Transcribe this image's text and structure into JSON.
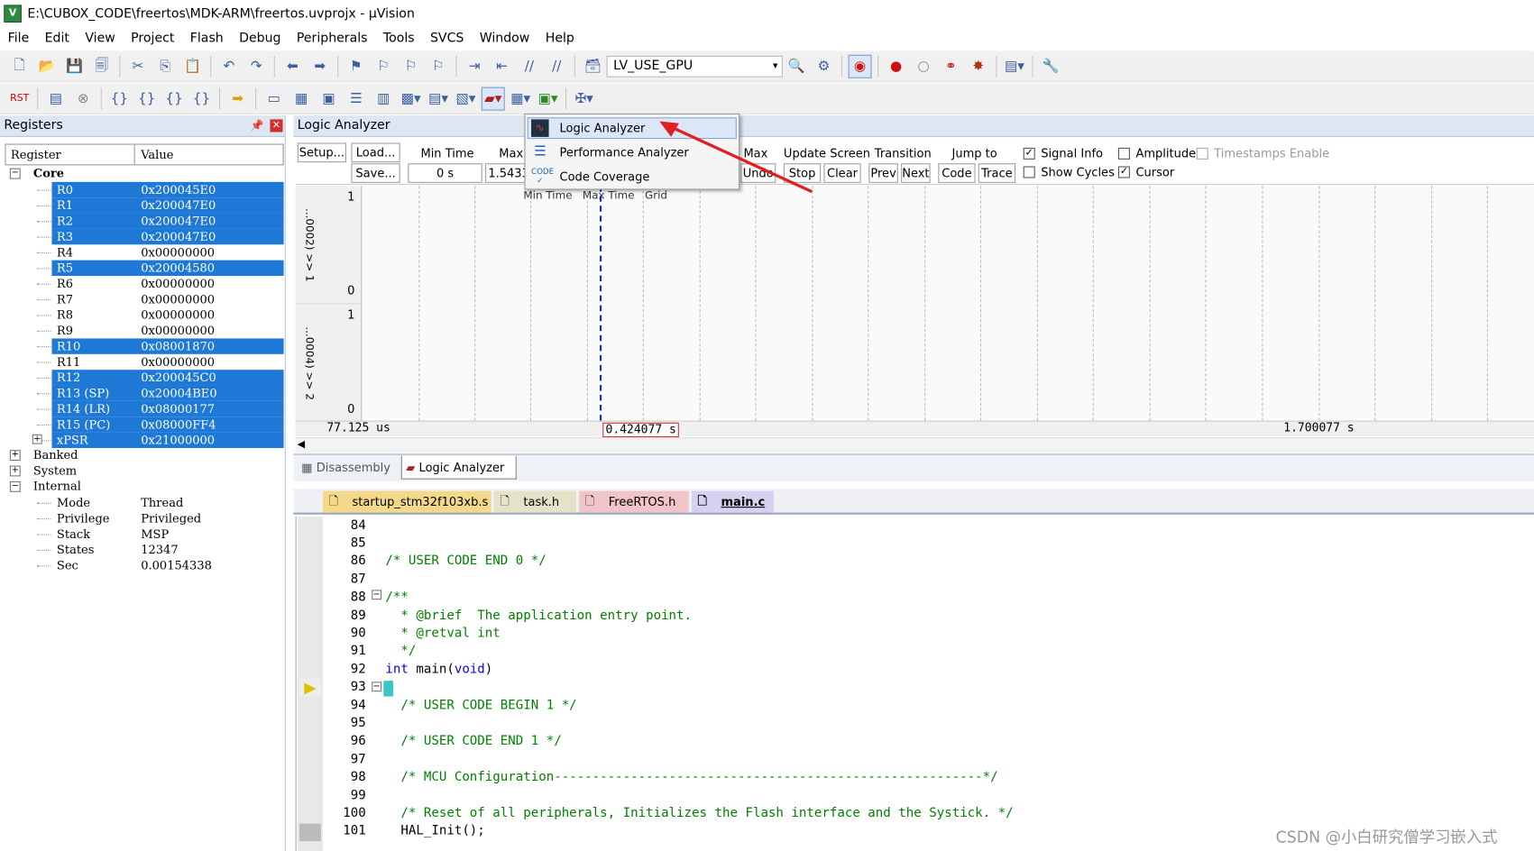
{
  "window": {
    "title": "E:\\CUBOX_CODE\\freertos\\MDK-ARM\\freertos.uvprojx - µVision",
    "app_icon": "uvision-icon"
  },
  "menu": [
    "File",
    "Edit",
    "View",
    "Project",
    "Flash",
    "Debug",
    "Peripherals",
    "Tools",
    "SVCS",
    "Window",
    "Help"
  ],
  "toolbar": {
    "target_combo": "LV_USE_GPU"
  },
  "registers": {
    "panel_title": "Registers",
    "col_register": "Register",
    "col_value": "Value",
    "groups": {
      "core": "Core",
      "banked": "Banked",
      "system": "System",
      "internal": "Internal"
    },
    "core": [
      {
        "name": "R0",
        "value": "0x200045E0"
      },
      {
        "name": "R1",
        "value": "0x200047E0"
      },
      {
        "name": "R2",
        "value": "0x200047E0"
      },
      {
        "name": "R3",
        "value": "0x200047E0"
      },
      {
        "name": "R4",
        "value": "0x00000000"
      },
      {
        "name": "R5",
        "value": "0x20004580"
      },
      {
        "name": "R6",
        "value": "0x00000000"
      },
      {
        "name": "R7",
        "value": "0x00000000"
      },
      {
        "name": "R8",
        "value": "0x00000000"
      },
      {
        "name": "R9",
        "value": "0x00000000"
      },
      {
        "name": "R10",
        "value": "0x08001870"
      },
      {
        "name": "R11",
        "value": "0x00000000"
      },
      {
        "name": "R12",
        "value": "0x200045C0"
      },
      {
        "name": "R13 (SP)",
        "value": "0x20004BE0"
      },
      {
        "name": "R14 (LR)",
        "value": "0x08000177"
      },
      {
        "name": "R15 (PC)",
        "value": "0x08000FF4"
      },
      {
        "name": "xPSR",
        "value": "0x21000000"
      }
    ],
    "internal": [
      {
        "name": "Mode",
        "value": "Thread"
      },
      {
        "name": "Privilege",
        "value": "Privileged"
      },
      {
        "name": "Stack",
        "value": "MSP"
      },
      {
        "name": "States",
        "value": "12347"
      },
      {
        "name": "Sec",
        "value": "0.00154338"
      }
    ]
  },
  "logic_analyzer": {
    "panel_title": "Logic Analyzer",
    "setup": "Setup...",
    "load": "Load...",
    "save": "Save...",
    "min_time_label": "Min Time",
    "min_time": "0 s",
    "max_label": "Max",
    "max_value": "1.5433",
    "max2_label": "Max",
    "undo": "Undo",
    "update_screen": "Update Screen",
    "stop": "Stop",
    "clear": "Clear",
    "transition": "Transition",
    "prev": "Prev",
    "next": "Next",
    "jump_to": "Jump to",
    "code": "Code",
    "trace": "Trace",
    "signal_info": "Signal Info",
    "show_cycles": "Show Cycles",
    "amplitude": "Amplitude",
    "cursor": "Cursor",
    "timestamps": "Timestamps Enable",
    "signal1": "...0002) >> 1",
    "signal2": "...0004) >> 2",
    "y_hi": "1",
    "y_lo": "0",
    "time_left": "77.125 us",
    "time_cursor": "0.424077 s",
    "time_right": "1.700077 s",
    "obscured_header": "Min Time   Max Time   Grid"
  },
  "dropdown": {
    "items": [
      {
        "label": "Logic Analyzer",
        "icon": "logic-analyzer-icon"
      },
      {
        "label": "Performance Analyzer",
        "icon": "performance-analyzer-icon"
      },
      {
        "label": "Code Coverage",
        "icon": "code-coverage-icon"
      }
    ]
  },
  "bottom_tabs": {
    "disassembly": "Disassembly",
    "logic_analyzer": "Logic Analyzer"
  },
  "file_tabs": [
    "startup_stm32f103xb.s",
    "task.h",
    "FreeRTOS.h",
    "main.c"
  ],
  "code": [
    {
      "n": "84",
      "t": ""
    },
    {
      "n": "85",
      "t": ""
    },
    {
      "n": "86",
      "t": "/* USER CODE END 0 */"
    },
    {
      "n": "87",
      "t": ""
    },
    {
      "n": "88",
      "t": "/**"
    },
    {
      "n": "89",
      "t": "  * @brief  The application entry point."
    },
    {
      "n": "90",
      "t": "  * @retval int"
    },
    {
      "n": "91",
      "t": "  */"
    },
    {
      "n": "92",
      "t": "int main(void)"
    },
    {
      "n": "93",
      "t": "{"
    },
    {
      "n": "94",
      "t": "  /* USER CODE BEGIN 1 */"
    },
    {
      "n": "95",
      "t": ""
    },
    {
      "n": "96",
      "t": "  /* USER CODE END 1 */"
    },
    {
      "n": "97",
      "t": ""
    },
    {
      "n": "98",
      "t": "  /* MCU Configuration--------------------------------------------------------*/"
    },
    {
      "n": "99",
      "t": ""
    },
    {
      "n": "100",
      "t": "  /* Reset of all peripherals, Initializes the Flash interface and the Systick. */"
    },
    {
      "n": "101",
      "t": "  HAL_Init();"
    }
  ],
  "watermark": "CSDN @小白研究僧学习嵌入式",
  "colors": {
    "selection": "#1e78d6",
    "comment": "#008000",
    "keyword": "#0000ff",
    "annotation_arrow": "#e02020"
  }
}
